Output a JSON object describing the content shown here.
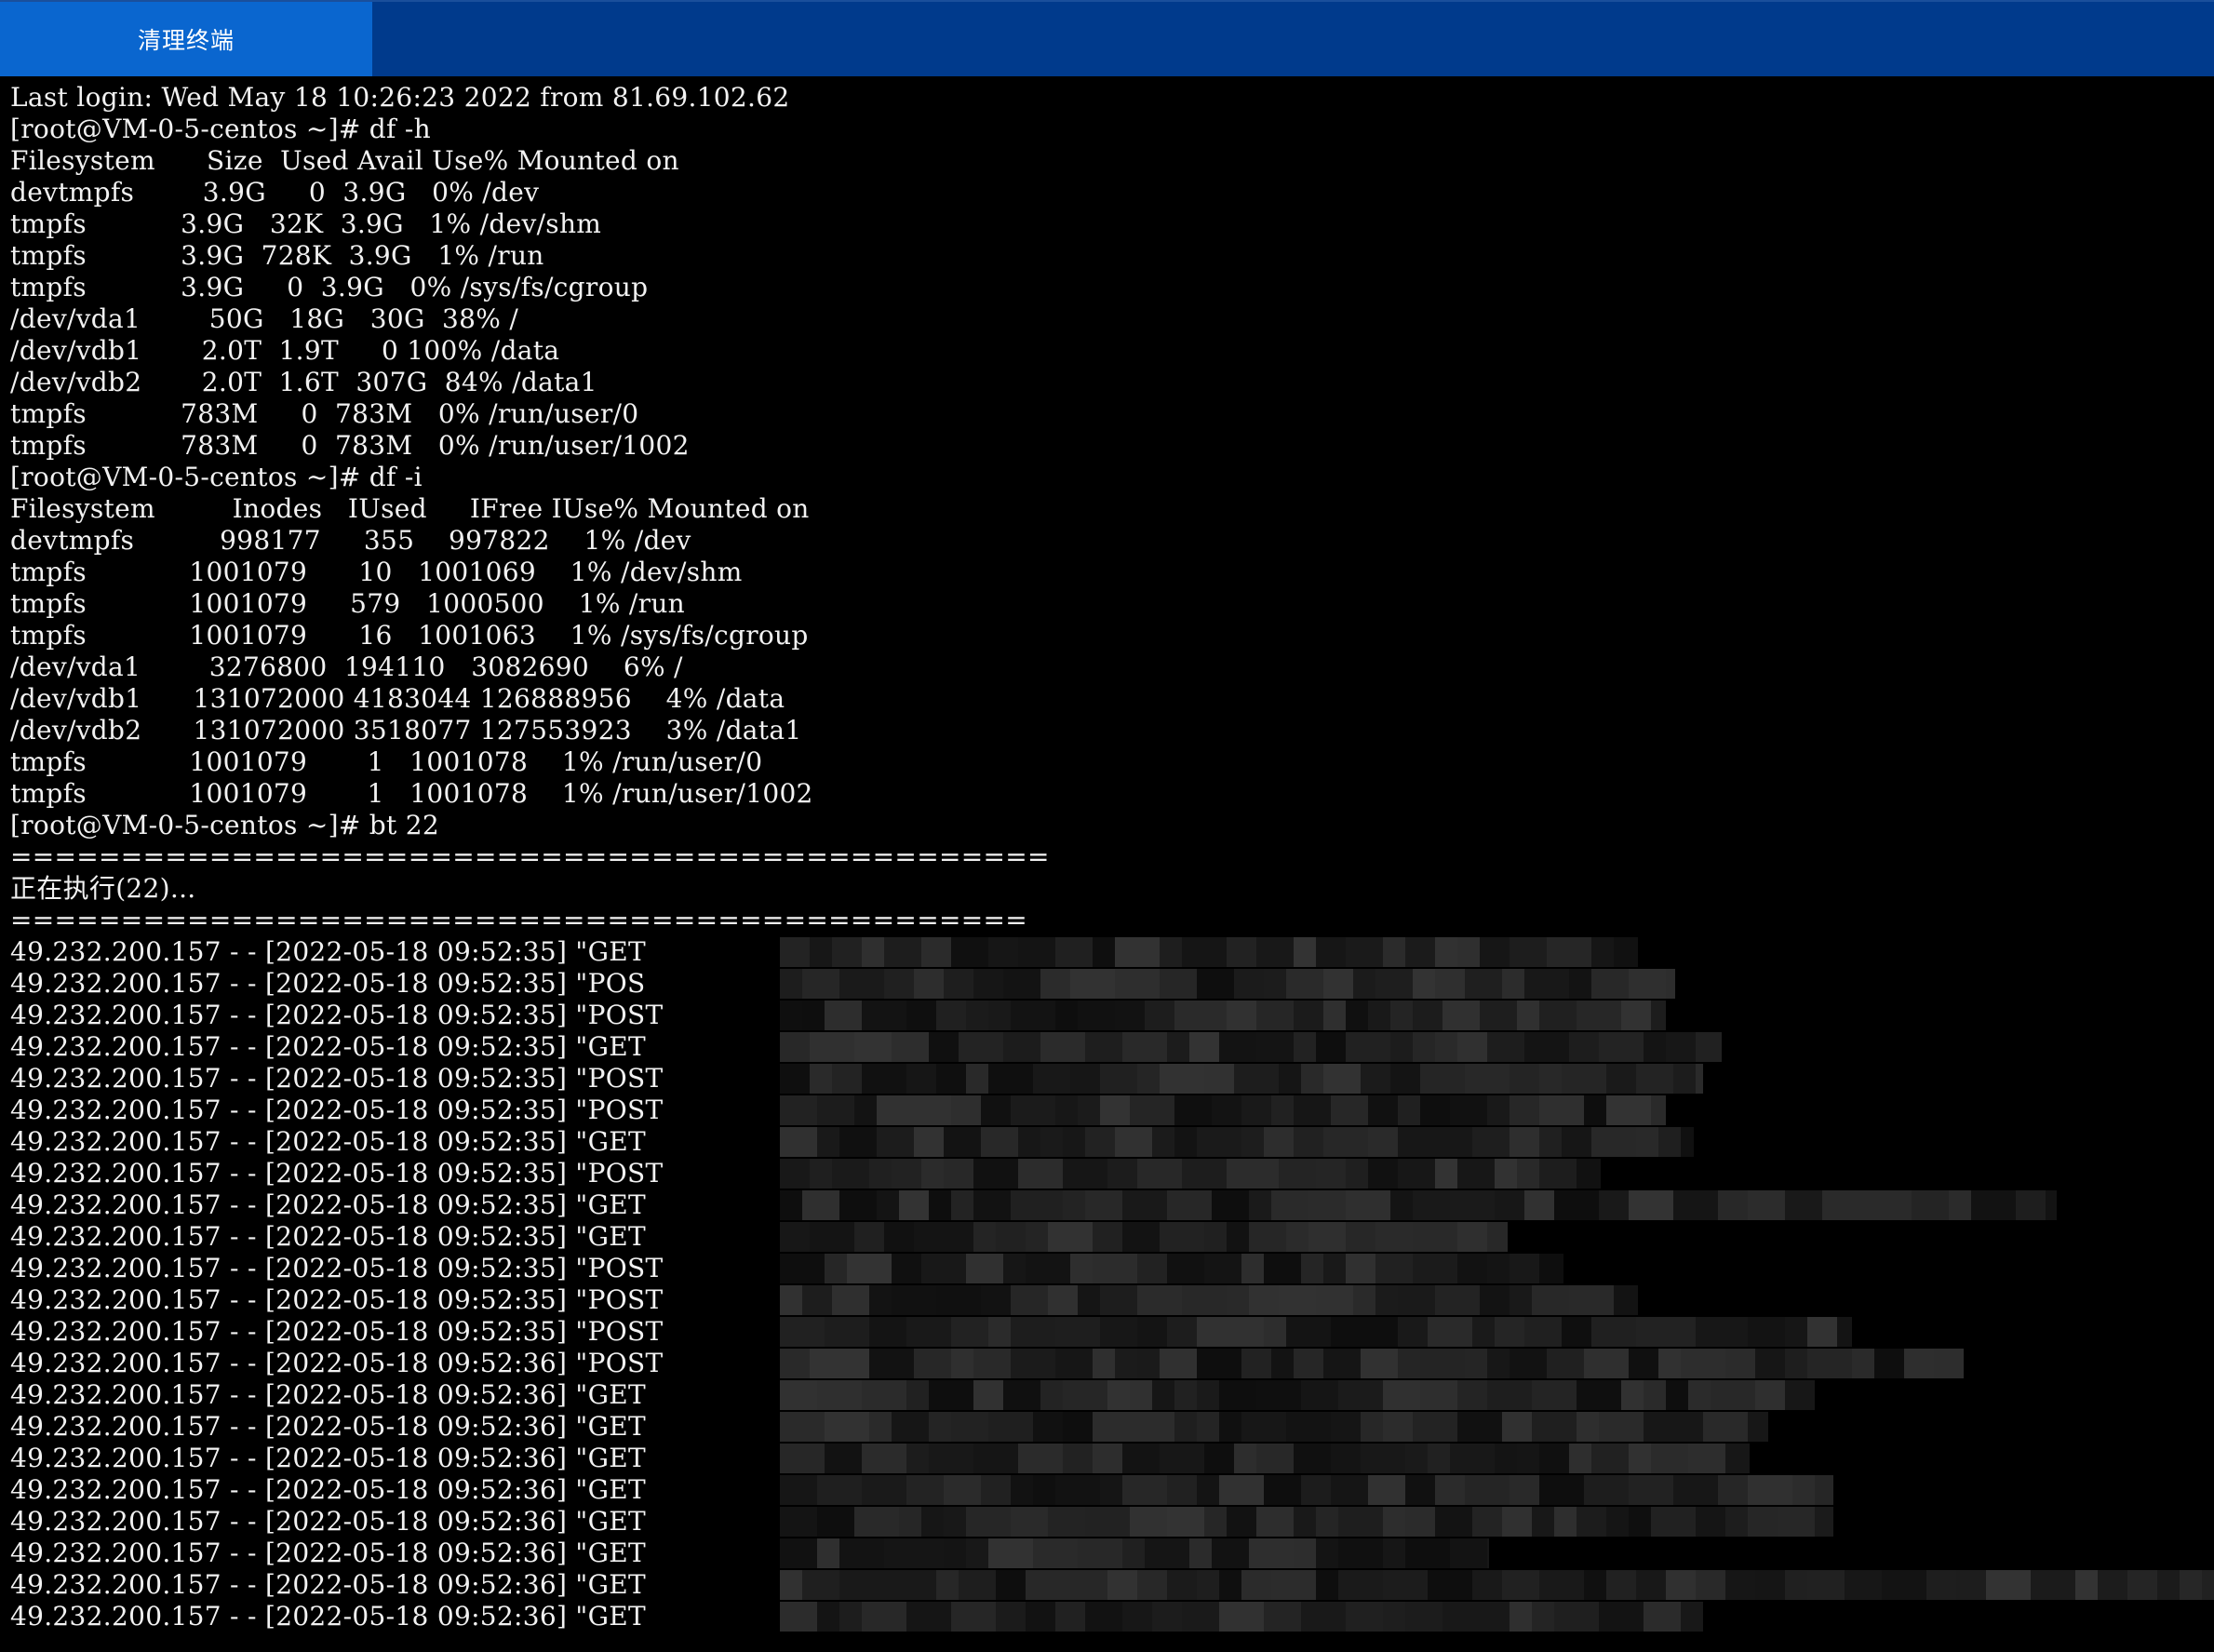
{
  "toolbar": {
    "clear_button": "清理终端"
  },
  "colors": {
    "topbar": "#003a8c",
    "clear_button": "#0a66cf",
    "terminal_bg": "#000000",
    "terminal_text": "#f2f2f2"
  },
  "terminal": {
    "lines": [
      "Last login: Wed May 18 10:26:23 2022 from 81.69.102.62",
      "[root@VM-0-5-centos ~]# df -h",
      "Filesystem      Size  Used Avail Use% Mounted on",
      "devtmpfs        3.9G     0  3.9G   0% /dev",
      "tmpfs           3.9G   32K  3.9G   1% /dev/shm",
      "tmpfs           3.9G  728K  3.9G   1% /run",
      "tmpfs           3.9G     0  3.9G   0% /sys/fs/cgroup",
      "/dev/vda1        50G   18G   30G  38% /",
      "/dev/vdb1       2.0T  1.9T     0 100% /data",
      "/dev/vdb2       2.0T  1.6T  307G  84% /data1",
      "tmpfs           783M     0  783M   0% /run/user/0",
      "tmpfs           783M     0  783M   0% /run/user/1002",
      "[root@VM-0-5-centos ~]# df -i",
      "Filesystem         Inodes   IUsed     IFree IUse% Mounted on",
      "devtmpfs          998177     355    997822    1% /dev",
      "tmpfs            1001079      10   1001069    1% /dev/shm",
      "tmpfs            1001079     579   1000500    1% /run",
      "tmpfs            1001079      16   1001063    1% /sys/fs/cgroup",
      "/dev/vda1        3276800  194110   3082690    6% /",
      "/dev/vdb1      131072000 4183044 126888956    4% /data",
      "/dev/vdb2      131072000 3518077 127553923    3% /data1",
      "tmpfs            1001079       1   1001078    1% /run/user/0",
      "tmpfs            1001079       1   1001078    1% /run/user/1002",
      "[root@VM-0-5-centos ~]# bt 22",
      "===============================================",
      "正在执行(22)...",
      "==============================================",
      "49.232.200.157 - - [2022-05-18 09:52:35] \"GET",
      "49.232.200.157 - - [2022-05-18 09:52:35] \"POS",
      "49.232.200.157 - - [2022-05-18 09:52:35] \"POST",
      "49.232.200.157 - - [2022-05-18 09:52:35] \"GET",
      "49.232.200.157 - - [2022-05-18 09:52:35] \"POST",
      "49.232.200.157 - - [2022-05-18 09:52:35] \"POST",
      "49.232.200.157 - - [2022-05-18 09:52:35] \"GET",
      "49.232.200.157 - - [2022-05-18 09:52:35] \"POST",
      "49.232.200.157 - - [2022-05-18 09:52:35] \"GET",
      "49.232.200.157 - - [2022-05-18 09:52:35] \"GET",
      "49.232.200.157 - - [2022-05-18 09:52:35] \"POST",
      "49.232.200.157 - - [2022-05-18 09:52:35] \"POST",
      "49.232.200.157 - - [2022-05-18 09:52:35] \"POST",
      "49.232.200.157 - - [2022-05-18 09:52:36] \"POST",
      "49.232.200.157 - - [2022-05-18 09:52:36] \"GET",
      "49.232.200.157 - - [2022-05-18 09:52:36] \"GET",
      "49.232.200.157 - - [2022-05-18 09:52:36] \"GET",
      "49.232.200.157 - - [2022-05-18 09:52:36] \"GET",
      "49.232.200.157 - - [2022-05-18 09:52:36] \"GET",
      "49.232.200.157 - - [2022-05-18 09:52:36] \"GET",
      "49.232.200.157 - - [2022-05-18 09:52:36] \"GET",
      "49.232.200.157 - - [2022-05-18 09:52:36] \"GET"
    ]
  }
}
